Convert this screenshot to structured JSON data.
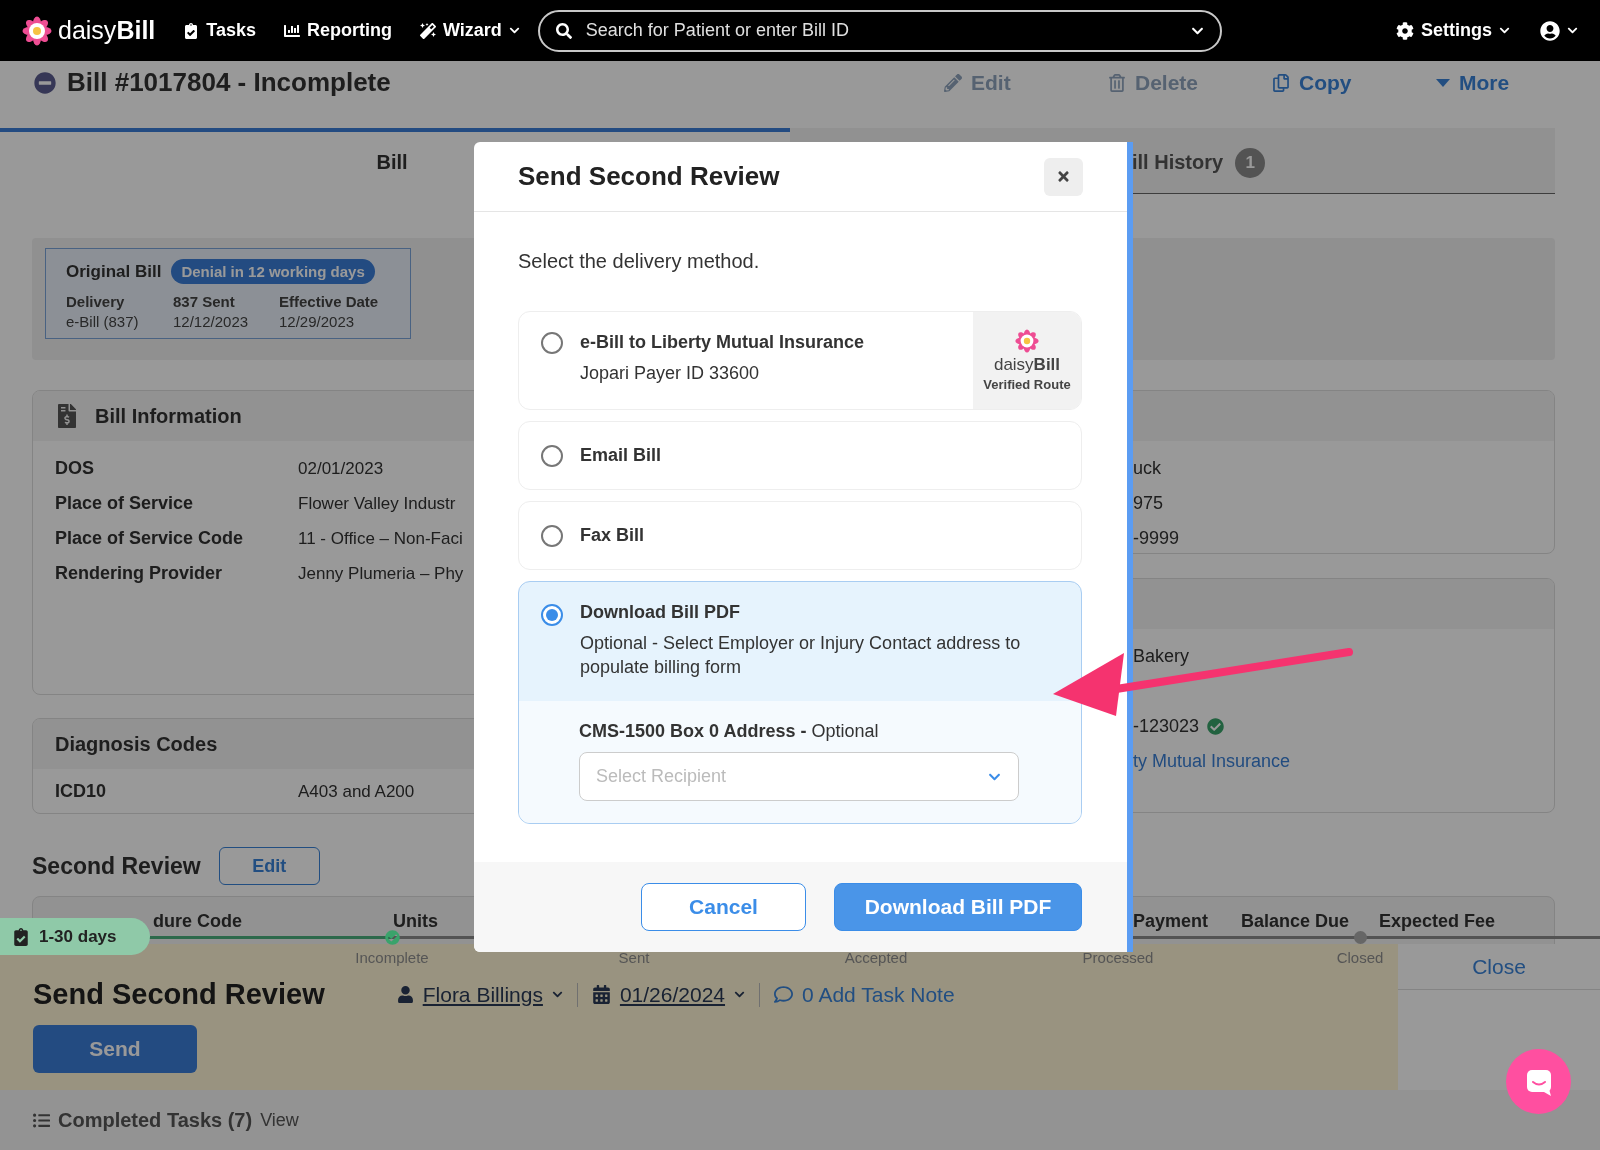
{
  "nav": {
    "brand": "daisy**Bill**",
    "items": [
      {
        "label": "Tasks",
        "dropdown": false
      },
      {
        "label": "Reporting",
        "dropdown": false
      },
      {
        "label": "Wizard",
        "dropdown": true
      }
    ],
    "search": {
      "placeholder": "Search for Patient or enter Bill ID"
    },
    "settings": "Settings"
  },
  "bill": {
    "title": "Bill #1017804 - Incomplete",
    "actions": [
      {
        "label": "Edit",
        "disabled": true
      },
      {
        "label": "Delete",
        "disabled": true
      },
      {
        "label": "Copy",
        "disabled": false
      },
      {
        "label": "More",
        "disabled": false
      }
    ]
  },
  "tabs": [
    {
      "label": "Bill",
      "selected": true
    },
    {
      "label": "ill History",
      "badge": "1",
      "selected": false
    }
  ],
  "original_bill": {
    "title": "Original Bill",
    "badge": "Denial in 12 working days",
    "fields": [
      {
        "label": "Delivery",
        "value": "e-Bill (837)"
      },
      {
        "label": "837 Sent",
        "value": "12/12/2023"
      },
      {
        "label": "Effective Date",
        "value": "12/29/2023"
      }
    ]
  },
  "bill_information": {
    "title": "Bill Information",
    "rows": [
      {
        "label": "DOS",
        "value": "02/01/2023"
      },
      {
        "label": "Place of Service",
        "value": "Flower Valley Industr"
      },
      {
        "label": "Place of Service Code",
        "value": "11 - Office – Non-Faci"
      },
      {
        "label": "Rendering Provider",
        "value": "Jenny Plumeria – Phy"
      }
    ]
  },
  "diagnosis_codes": {
    "title": "Diagnosis Codes",
    "rows": [
      {
        "label": "ICD10",
        "value": "A403 and A200"
      }
    ]
  },
  "patient_panel": {
    "rows": [
      "uck",
      "975",
      "-9999"
    ]
  },
  "employer_panel": {
    "rows": [
      {
        "text": "Bakery",
        "kind": "text",
        "verified": false
      },
      {
        "text": "-123023",
        "kind": "text",
        "verified": true
      },
      {
        "text": "ty Mutual Insurance",
        "kind": "link",
        "verified": false
      }
    ]
  },
  "second_review": {
    "title": "Second Review",
    "edit": "Edit",
    "columns": [
      "dure Code",
      "Units",
      "Payment",
      "Balance Due",
      "Expected Fee"
    ]
  },
  "task": {
    "timer": "1-30 days",
    "steps": [
      {
        "label": "Incomplete",
        "kind": "check"
      },
      {
        "label": "Sent",
        "kind": "none"
      },
      {
        "label": "Accepted",
        "kind": "none"
      },
      {
        "label": "Processed",
        "kind": "none"
      },
      {
        "label": "Closed",
        "kind": "dot"
      }
    ],
    "close": "Close",
    "title": "Send Second Review",
    "assignee": "Flora Billings",
    "due_date": "01/26/2024",
    "task_note": "0 Add Task Note",
    "send": "Send"
  },
  "completed_tasks": {
    "label": "Completed Tasks (7)",
    "link": "View"
  },
  "modal": {
    "title": "Send Second Review",
    "prompt": "Select the delivery method.",
    "options": [
      {
        "title": "e-Bill to Liberty Mutual Insurance",
        "subtitle": "Jopari Payer ID 33600",
        "selected": false,
        "badge": {
          "brand": "daisy**Bill**",
          "caption": "Verified Route"
        }
      },
      {
        "title": "Email Bill",
        "selected": false
      },
      {
        "title": "Fax Bill",
        "selected": false
      },
      {
        "title": "Download Bill PDF",
        "subtitle": "Optional - Select Employer or Injury Contact address to populate billing form",
        "selected": true,
        "field": {
          "label": "**CMS-1500 Box 0 Address -** Optional",
          "placeholder": "Select Recipient"
        }
      }
    ],
    "buttons": [
      {
        "label": "Cancel",
        "kind": "secondary"
      },
      {
        "label": "Download Bill PDF",
        "kind": "primary"
      }
    ]
  }
}
